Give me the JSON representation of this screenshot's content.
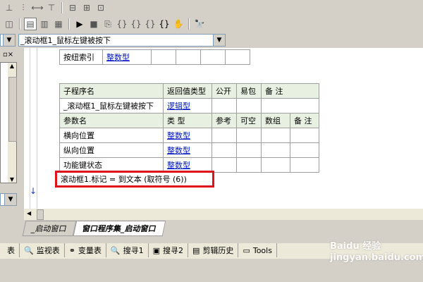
{
  "toolbar1": {
    "icons": [
      "align-top-icon",
      "distribute-h-icon",
      "distribute-v-icon",
      "align-center-icon",
      "same-width-icon",
      "same-height-icon",
      "same-size-icon"
    ]
  },
  "toolbar2": {
    "icons": [
      "view-icon",
      "layout-a-icon",
      "layout-b-icon",
      "layout-c-icon",
      "run-icon",
      "stop-icon",
      "step-icon",
      "step-into-icon",
      "step-out-icon",
      "watch-icon",
      "brace-icon",
      "hand-icon",
      "find-icon"
    ]
  },
  "event_combo": {
    "value": "_滚动框1_鼠标左键被按下"
  },
  "top_table": {
    "label": "按纽索引",
    "type": "整数型"
  },
  "sub_table": {
    "headers": [
      "子程序名",
      "返回值类型",
      "公开",
      "易包",
      "备 注"
    ],
    "row": [
      "_滚动框1_鼠标左键被按下",
      "逻辑型",
      "",
      "",
      ""
    ],
    "param_headers": [
      "参数名",
      "类 型",
      "参考",
      "可空",
      "数组",
      "备 注"
    ],
    "params": [
      [
        "横向位置",
        "整数型"
      ],
      [
        "纵向位置",
        "整数型"
      ],
      [
        "功能键状态",
        "整数型"
      ]
    ]
  },
  "code_line": "滚动框1.标记 = 到文本 (取符号 (6))",
  "tabs": [
    "_启动窗口",
    "窗口程序集_启动窗口"
  ],
  "bottom_tabs": [
    {
      "icon": "table-icon",
      "label": "表"
    },
    {
      "icon": "magnifier-icon",
      "label": "监视表"
    },
    {
      "icon": "variable-icon",
      "label": "变量表"
    },
    {
      "icon": "search-icon",
      "label": "搜寻1"
    },
    {
      "icon": "search2-icon",
      "label": "搜寻2"
    },
    {
      "icon": "clipboard-icon",
      "label": "剪辑历史"
    },
    {
      "icon": "window-icon",
      "label": "Tools"
    }
  ],
  "watermark": "Baidu 经验\njingyan.baidu.com",
  "colors": {
    "accent_red": "#e0131b",
    "link_blue": "#0018c4",
    "header_green": "#e8f1e1"
  }
}
